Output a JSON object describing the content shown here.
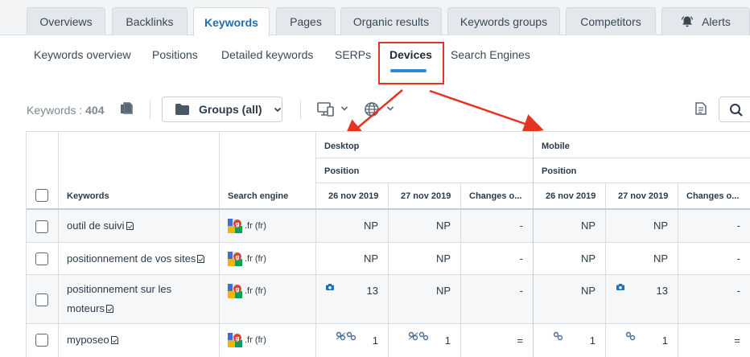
{
  "tabs": [
    {
      "label": "Overviews",
      "active": false
    },
    {
      "label": "Backlinks",
      "active": false
    },
    {
      "label": "Keywords",
      "active": true
    },
    {
      "label": "Pages",
      "active": false
    },
    {
      "label": "Organic results",
      "active": false
    },
    {
      "label": "Keywords groups",
      "active": false
    },
    {
      "label": "Competitors",
      "active": false
    },
    {
      "label": "Alerts",
      "active": false,
      "icon": "bell-icon"
    }
  ],
  "subnav": [
    {
      "label": "Keywords overview",
      "active": false
    },
    {
      "label": "Positions",
      "active": false
    },
    {
      "label": "Detailed keywords",
      "active": false
    },
    {
      "label": "SERPs",
      "active": false
    },
    {
      "label": "Devices",
      "active": true
    },
    {
      "label": "Search Engines",
      "active": false
    }
  ],
  "toolbar": {
    "keywords_label": "Keywords : ",
    "keywords_count": "404",
    "groups_label": "Groups (all)"
  },
  "table": {
    "col_keywords": "Keywords",
    "col_engine": "Search engine",
    "groups": [
      {
        "device": "Desktop",
        "metric": "Position",
        "dates": [
          "26 nov 2019",
          "27 nov 2019",
          "Changes o..."
        ]
      },
      {
        "device": "Mobile",
        "metric": "Position",
        "dates": [
          "26 nov 2019",
          "27 nov 2019",
          "Changes o..."
        ]
      }
    ],
    "rows": [
      {
        "keyword": "outil de suivi",
        "engine": ".fr (fr)",
        "desktop": [
          "NP",
          "NP",
          "-"
        ],
        "mobile": [
          "NP",
          "NP",
          "-"
        ]
      },
      {
        "keyword": "positionnement de vos sites",
        "engine": ".fr (fr)",
        "desktop": [
          "NP",
          "NP",
          "-"
        ],
        "mobile": [
          "NP",
          "NP",
          "-"
        ]
      },
      {
        "keyword_line1": "positionnement sur les",
        "keyword_line2": "moteurs",
        "engine": ".fr (fr)",
        "desktop": [
          "13",
          "NP",
          "-"
        ],
        "mobile": [
          "NP",
          "13",
          "-"
        ]
      },
      {
        "keyword": "myposeo",
        "engine": ".fr (fr)",
        "desktop": [
          "1",
          "1",
          "="
        ],
        "mobile": [
          "1",
          "1",
          "="
        ]
      }
    ]
  },
  "colors": {
    "accent": "#1e6fb3",
    "underline": "#2b8ad8",
    "annotation": "#e53322"
  }
}
